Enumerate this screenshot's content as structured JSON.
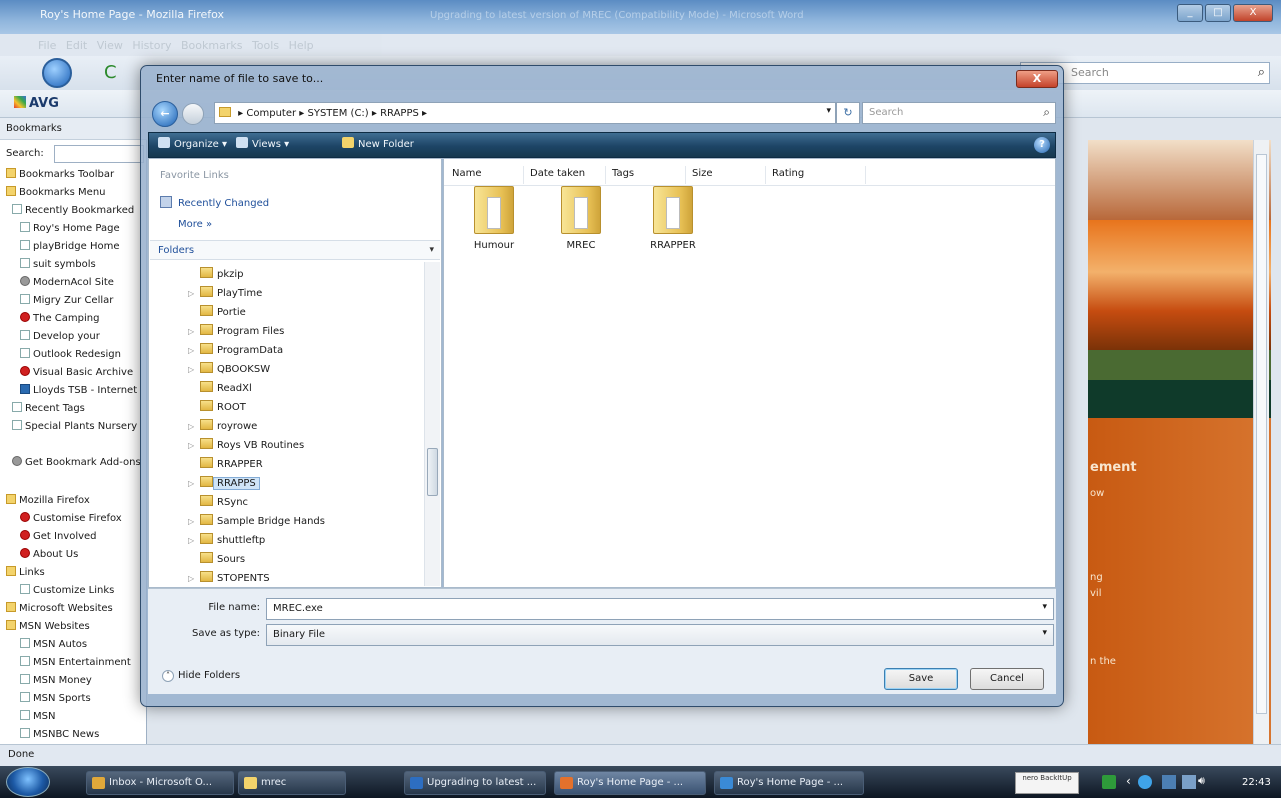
{
  "browser": {
    "title": "Roy's Home Page - Mozilla Firefox",
    "background_title": "Upgrading to latest version of MREC (Compatibility Mode) - Microsoft Word",
    "menu": [
      "File",
      "Edit",
      "View",
      "History",
      "Bookmarks",
      "Tools",
      "Help"
    ],
    "search_placeholder": "Search",
    "toolbar_brand": "AVG",
    "status": "Done",
    "window_buttons": [
      "_",
      "□",
      "X"
    ]
  },
  "sidebar": {
    "header": "Bookmarks",
    "search_label": "Search:",
    "items": [
      {
        "label": "Bookmarks Toolbar",
        "icon": "folder"
      },
      {
        "label": "Bookmarks Menu",
        "icon": "folder"
      },
      {
        "label": "Recently Bookmarked",
        "icon": "page"
      },
      {
        "label": "Roy's Home Page",
        "icon": "page"
      },
      {
        "label": "playBridge Home",
        "icon": "page"
      },
      {
        "label": "suit symbols",
        "icon": "page"
      },
      {
        "label": "ModernAcol Site",
        "icon": "gear"
      },
      {
        "label": "Migry Zur Cellar",
        "icon": "page"
      },
      {
        "label": "The Camping",
        "icon": "flag"
      },
      {
        "label": "Develop your",
        "icon": "page"
      },
      {
        "label": "Outlook Redesign",
        "icon": "page"
      },
      {
        "label": "Visual Basic Archive",
        "icon": "red"
      },
      {
        "label": "Lloyds TSB - Internet",
        "icon": "blue"
      },
      {
        "label": "Recent Tags",
        "icon": "page"
      },
      {
        "label": "Special Plants Nursery",
        "icon": "page"
      },
      {
        "label": "Get Bookmark Add-ons",
        "icon": "gear"
      },
      {
        "label": "Mozilla Firefox",
        "icon": "folder"
      },
      {
        "label": "Customise Firefox",
        "icon": "red"
      },
      {
        "label": "Get Involved",
        "icon": "red"
      },
      {
        "label": "About Us",
        "icon": "red"
      },
      {
        "label": "Links",
        "icon": "folder"
      },
      {
        "label": "Customize Links",
        "icon": "page"
      },
      {
        "label": "Microsoft Websites",
        "icon": "folder"
      },
      {
        "label": "MSN Websites",
        "icon": "folder"
      },
      {
        "label": "MSN Autos",
        "icon": "page"
      },
      {
        "label": "MSN Entertainment",
        "icon": "page"
      },
      {
        "label": "MSN Money",
        "icon": "page"
      },
      {
        "label": "MSN Sports",
        "icon": "page"
      },
      {
        "label": "MSN",
        "icon": "page"
      },
      {
        "label": "MSNBC News",
        "icon": "page"
      }
    ]
  },
  "page": {
    "heading": "ement",
    "snippets": [
      "ow",
      "ng",
      "vil",
      "n the"
    ]
  },
  "dialog": {
    "title": "Enter name of file to save to...",
    "close": "X",
    "breadcrumb": [
      "Computer",
      "SYSTEM (C:)",
      "RRAPPS"
    ],
    "search_placeholder": "Search",
    "commands": {
      "organize": "Organize",
      "views": "Views",
      "new_folder": "New Folder"
    },
    "favorite_links_header": "Favorite Links",
    "favorite_links": [
      "Recently Changed"
    ],
    "more": "More",
    "folders_header": "Folders",
    "folder_tree": [
      {
        "name": "pkzip",
        "expandable": false
      },
      {
        "name": "PlayTime",
        "expandable": true
      },
      {
        "name": "Portie",
        "expandable": false
      },
      {
        "name": "Program Files",
        "expandable": true
      },
      {
        "name": "ProgramData",
        "expandable": true
      },
      {
        "name": "QBOOKSW",
        "expandable": true
      },
      {
        "name": "ReadXl",
        "expandable": false
      },
      {
        "name": "ROOT",
        "expandable": false
      },
      {
        "name": "royrowe",
        "expandable": true
      },
      {
        "name": "Roys VB Routines",
        "expandable": true
      },
      {
        "name": "RRAPPER",
        "expandable": false
      },
      {
        "name": "RRAPPS",
        "expandable": true,
        "selected": true
      },
      {
        "name": "RSync",
        "expandable": false
      },
      {
        "name": "Sample Bridge Hands",
        "expandable": true
      },
      {
        "name": "shuttleftp",
        "expandable": true
      },
      {
        "name": "Sours",
        "expandable": false
      },
      {
        "name": "STOPENTS",
        "expandable": true
      }
    ],
    "columns": [
      "Name",
      "Date taken",
      "Tags",
      "Size",
      "Rating"
    ],
    "files": [
      {
        "name": "Humour",
        "type": "folder"
      },
      {
        "name": "MREC",
        "type": "folder"
      },
      {
        "name": "RRAPPER",
        "type": "folder"
      }
    ],
    "file_name_label": "File name:",
    "file_name_value": "MREC.exe",
    "save_type_label": "Save as type:",
    "save_type_value": "Binary File",
    "hide_folders": "Hide Folders",
    "save": "Save",
    "cancel": "Cancel"
  },
  "taskbar": {
    "items": [
      {
        "label": "Inbox - Microsoft O...",
        "color": "#e0a83a"
      },
      {
        "label": "mrec",
        "color": "#f3d36b"
      },
      {
        "label": "Upgrading to latest ...",
        "color": "#2d6ec1"
      },
      {
        "label": "Roy's Home Page - ...",
        "color": "#e3712c"
      },
      {
        "label": "Roy's Home Page - ...",
        "color": "#3a8ad6"
      }
    ],
    "clock": "22:43",
    "nero": "nero BackItUp"
  }
}
